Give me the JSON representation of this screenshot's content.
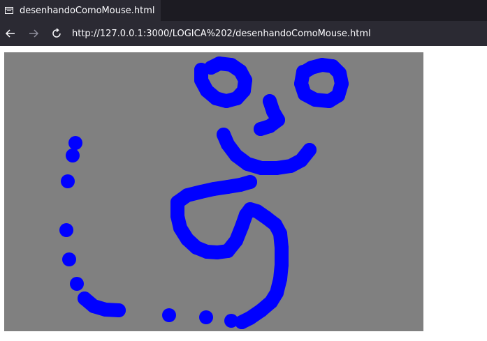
{
  "tab": {
    "title": "desenhandoComoMouse.html",
    "icon": "page-icon"
  },
  "navigation": {
    "back_icon": "arrow-left-icon",
    "forward_icon": "arrow-right-icon",
    "reload_icon": "reload-icon",
    "url": "http://127.0.0.1:3000/LOGICA%202/desenhandoComoMouse.html"
  },
  "canvas": {
    "background_color": "#808080",
    "stroke_color": "#0000ff",
    "brush_shape": "circle"
  }
}
